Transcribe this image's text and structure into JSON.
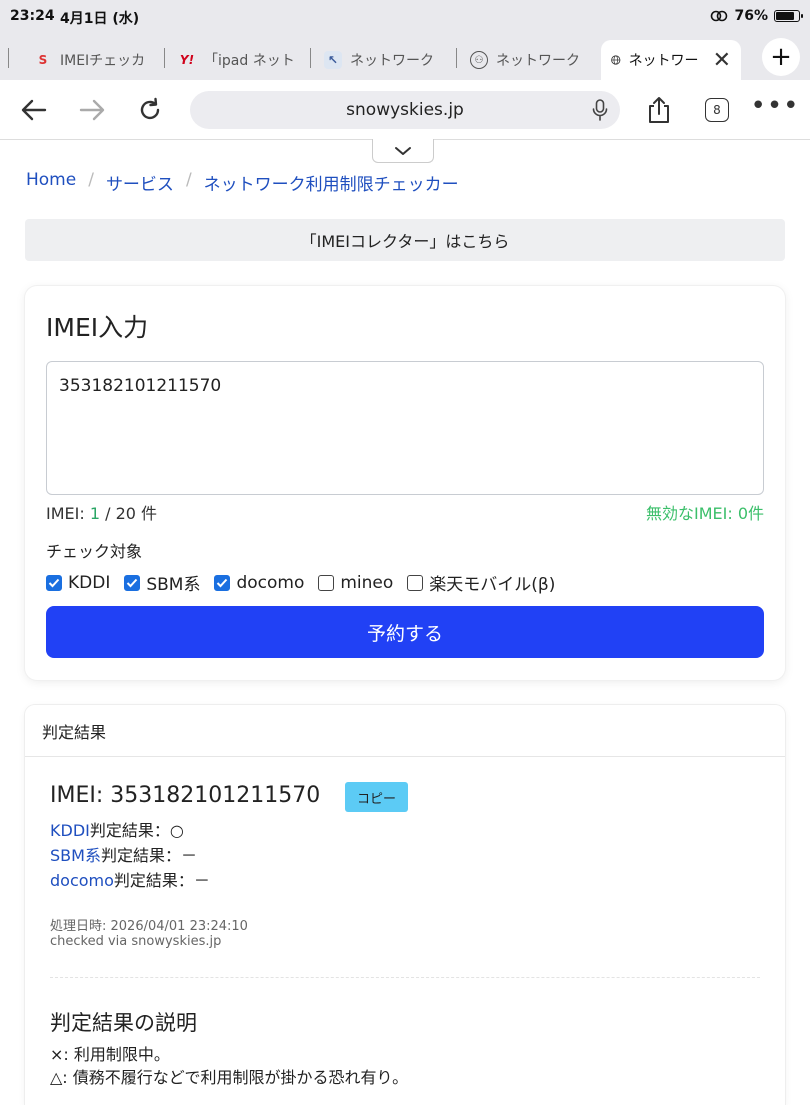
{
  "status": {
    "time": "23:24",
    "date": "4月1日 (水)",
    "battery": "76%"
  },
  "tabs": [
    {
      "label": "IMEIチェッカ",
      "favicon": "S"
    },
    {
      "label": "「ipad ネット",
      "favicon": "Y!"
    },
    {
      "label": "ネットワーク",
      "favicon": "N"
    },
    {
      "label": "ネットワーク",
      "favicon": "N"
    },
    {
      "label": "ネットワー",
      "favicon": "globe"
    }
  ],
  "toolbar": {
    "url": "snowyskies.jp",
    "tab_count": "8"
  },
  "breadcrumb": {
    "home": "Home",
    "services": "サービス",
    "current": "ネットワーク利用制限チェッカー"
  },
  "collector_link": "「IMEIコレクター」はこちら",
  "imei_card": {
    "title": "IMEI入力",
    "input_value": "353182101211570",
    "count_prefix": "IMEI: ",
    "count_num": "1",
    "count_suffix": " / 20 件",
    "invalid": "無効なIMEI: 0件",
    "target_label": "チェック対象",
    "checks": [
      {
        "label": "KDDI",
        "checked": true
      },
      {
        "label": "SBM系",
        "checked": true
      },
      {
        "label": "docomo",
        "checked": true
      },
      {
        "label": "mineo",
        "checked": false
      },
      {
        "label": "楽天モバイル(β)",
        "checked": false
      }
    ],
    "submit": "予約する"
  },
  "result": {
    "header": "判定結果",
    "imei": "IMEI: 353182101211570",
    "copy": "コピー",
    "lines": [
      {
        "carrier": "KDDI",
        "text": "判定結果：○"
      },
      {
        "carrier": "SBM系",
        "text": "判定結果：－"
      },
      {
        "carrier": "docomo",
        "text": "判定結果：－"
      }
    ],
    "processed": "処理日時: 2026/04/01 23:24:10",
    "via": "checked via snowyskies.jp",
    "explanation_title": "判定結果の説明",
    "explanations": [
      "×: 利用制限中。",
      "△: 債務不履行などで利用制限が掛かる恐れ有り。"
    ]
  }
}
